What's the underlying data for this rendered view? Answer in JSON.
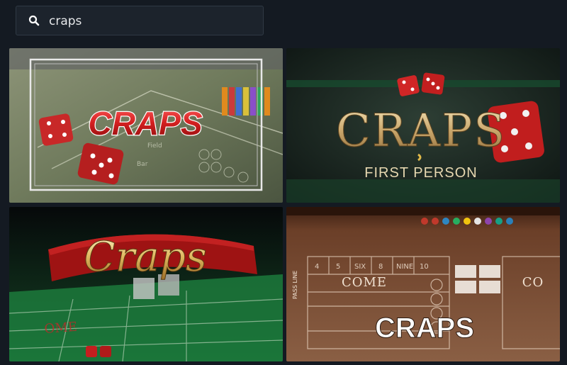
{
  "search": {
    "value": "craps",
    "icon": "search-icon"
  },
  "games": [
    {
      "title": "CRAPS",
      "subtitle": ""
    },
    {
      "title": "CRAPS",
      "subtitle": "FIRST PERSON"
    },
    {
      "title": "Craps",
      "subtitle": ""
    },
    {
      "title": "CRAPS",
      "subtitle": ""
    }
  ],
  "table_text": {
    "come": "COME",
    "co": "CO",
    "field": "Field",
    "bar": "Bar",
    "pass_line": "PASS LINE",
    "nums": [
      "4",
      "5",
      "SIX",
      "8",
      "NINE",
      "10"
    ]
  }
}
